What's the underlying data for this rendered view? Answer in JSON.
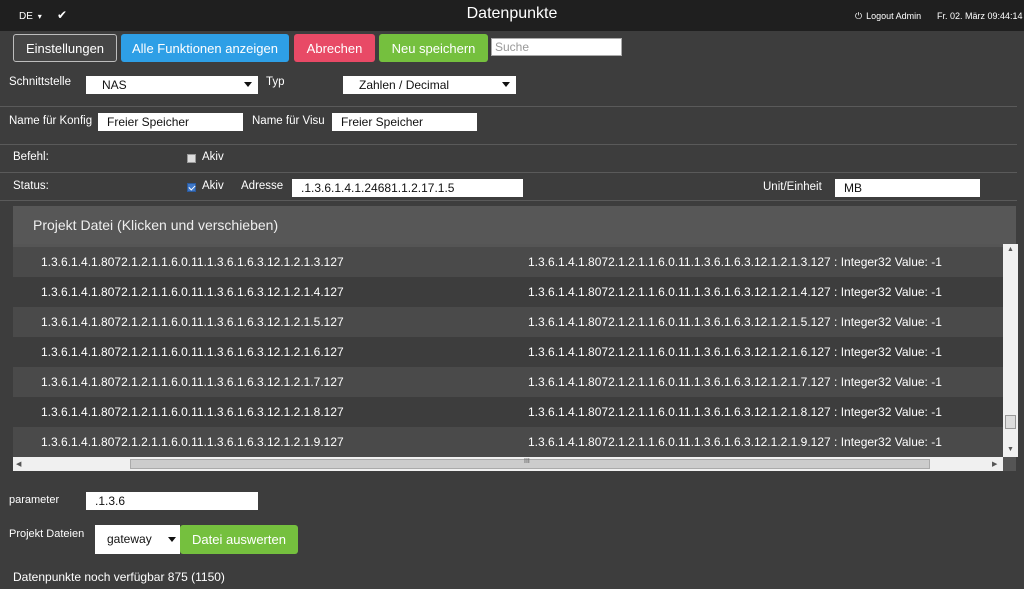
{
  "topbar": {
    "language": "DE",
    "language_caret": "▾",
    "check_glyph": "✔",
    "title": "Datenpunkte",
    "power_glyph": "⏻",
    "logout": "Logout Admin",
    "datetime": "Fr. 02. März 09:44:14"
  },
  "toolbar": {
    "settings": "Einstellungen",
    "all_functions": "Alle Funktionen anzeigen",
    "cancel": "Abrechen",
    "save_new": "Neu speichern",
    "search_placeholder": "Suche",
    "colors": {
      "blue": "#2e9fe6",
      "red": "#e84a66",
      "green": "#75c03e"
    }
  },
  "form": {
    "interface_label": "Schnittstelle",
    "interface_value": "NAS",
    "type_label": "Typ",
    "type_value": "Zahlen / Decimal",
    "config_name_label": "Name für Konfig",
    "config_name_value": "Freier Speicher",
    "visu_name_label": "Name für Visu",
    "visu_name_value": "Freier Speicher",
    "command_label": "Befehl:",
    "command_active_label": "Akiv",
    "command_active_checked": false,
    "status_label": "Status:",
    "status_active_label": "Akiv",
    "status_active_checked": true,
    "address_label": "Adresse",
    "address_value": ".1.3.6.1.4.1.24681.1.2.17.1.5",
    "unit_label": "Unit/Einheit",
    "unit_value": "MB"
  },
  "project_file": {
    "title": "Projekt Datei (Klicken und verschieben)",
    "rows": [
      {
        "oid": "1.3.6.1.4.1.8072.1.2.1.1.6.0.11.1.3.6.1.6.3.12.1.2.1.3.127",
        "value": "1.3.6.1.4.1.8072.1.2.1.1.6.0.11.1.3.6.1.6.3.12.1.2.1.3.127 : Integer32 Value: -1"
      },
      {
        "oid": "1.3.6.1.4.1.8072.1.2.1.1.6.0.11.1.3.6.1.6.3.12.1.2.1.4.127",
        "value": "1.3.6.1.4.1.8072.1.2.1.1.6.0.11.1.3.6.1.6.3.12.1.2.1.4.127 : Integer32 Value: -1"
      },
      {
        "oid": "1.3.6.1.4.1.8072.1.2.1.1.6.0.11.1.3.6.1.6.3.12.1.2.1.5.127",
        "value": "1.3.6.1.4.1.8072.1.2.1.1.6.0.11.1.3.6.1.6.3.12.1.2.1.5.127 : Integer32 Value: -1"
      },
      {
        "oid": "1.3.6.1.4.1.8072.1.2.1.1.6.0.11.1.3.6.1.6.3.12.1.2.1.6.127",
        "value": "1.3.6.1.4.1.8072.1.2.1.1.6.0.11.1.3.6.1.6.3.12.1.2.1.6.127 : Integer32 Value: -1"
      },
      {
        "oid": "1.3.6.1.4.1.8072.1.2.1.1.6.0.11.1.3.6.1.6.3.12.1.2.1.7.127",
        "value": "1.3.6.1.4.1.8072.1.2.1.1.6.0.11.1.3.6.1.6.3.12.1.2.1.7.127 : Integer32 Value: -1"
      },
      {
        "oid": "1.3.6.1.4.1.8072.1.2.1.1.6.0.11.1.3.6.1.6.3.12.1.2.1.8.127",
        "value": "1.3.6.1.4.1.8072.1.2.1.1.6.0.11.1.3.6.1.6.3.12.1.2.1.8.127 : Integer32 Value: -1"
      },
      {
        "oid": "1.3.6.1.4.1.8072.1.2.1.1.6.0.11.1.3.6.1.6.3.12.1.2.1.9.127",
        "value": "1.3.6.1.4.1.8072.1.2.1.1.6.0.11.1.3.6.1.6.3.12.1.2.1.9.127 : Integer32 Value: -1"
      }
    ],
    "hscroll_grip": "III"
  },
  "bottom": {
    "parameter_label": "parameter",
    "parameter_value": ".1.3.6",
    "project_files_label": "Projekt Dateien",
    "project_files_value": "gateway",
    "evaluate_button": "Datei auswerten",
    "available_text": "Datenpunkte noch verfügbar 875 (1150)"
  }
}
